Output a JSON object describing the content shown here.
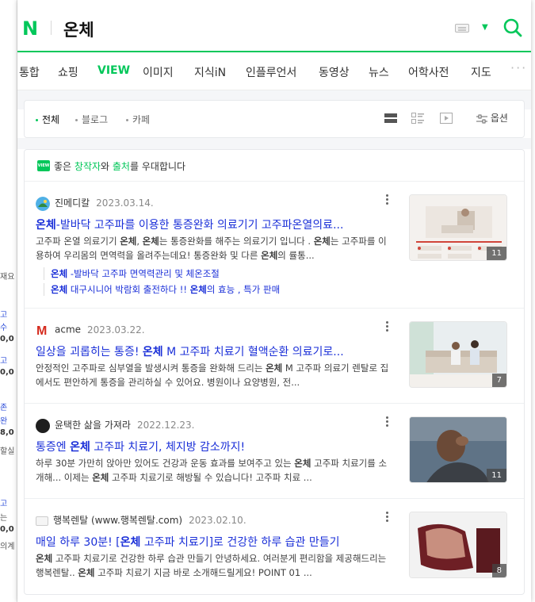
{
  "search": {
    "query": "온체",
    "logo": "N"
  },
  "tabs": [
    {
      "label": "통합"
    },
    {
      "label": "쇼핑"
    },
    {
      "label": "VIEW"
    },
    {
      "label": "이미지"
    },
    {
      "label": "지식iN"
    },
    {
      "label": "인플루언서"
    },
    {
      "label": "동영상"
    },
    {
      "label": "뉴스"
    },
    {
      "label": "어학사전"
    },
    {
      "label": "지도"
    }
  ],
  "filters": {
    "all": "전체",
    "blog": "블로그",
    "cafe": "카페",
    "options": "옵션"
  },
  "notice": {
    "badge": "VIEW",
    "pre": "좋은 ",
    "creator": "창작자",
    "mid": "와 ",
    "source": "출처",
    "post": "를 우대합니다"
  },
  "results": [
    {
      "source": "진메디칼",
      "date": "2023.03.14.",
      "title": "온체-발바닥 고주파를 이용한 통증완화 의료기기 고주파온열의료...",
      "desc": "고주파 온열 의료기기 온체, 온체는 통증완화를 해주는 의료기기 입니다 . 온체는 고주파를 이용하여 우리몸의 면역력을 올려주는데요! 통증완화 및 다른 온체의 률통...",
      "sub1": "온체 -발바닥 고주파 면역력관리 및 체온조절",
      "sub2": "온체 대구시니어 박람회 출전하다 !! 온체의 효능 , 특가 판매",
      "count": "11"
    },
    {
      "source": "acme",
      "date": "2023.03.22.",
      "title": "일상을 괴롭히는 통증! 온체 M 고주파 치료기 혈액순환 의료기로...",
      "desc": "안정적인 고주파로 심부열을 발생시켜 통증을 완화해 드리는 온체 M 고주파 의료기 렌탈로 집에서도 편안하게 통증을 관리하실 수 있어요. 병원이나 요양병원, 전...",
      "count": "7"
    },
    {
      "source": "윤택한 삶을 가져라",
      "date": "2022.12.23.",
      "title": "통증엔 온체 고주파 치료기, 체지방 감소까지!",
      "desc": "하루 30분 가만히 앉아만 있어도 건강과 운동 효과를 보여주고 있는 온체 고주파 치료기를 소개해... 이제는 온체 고주파 치료기로 해방될 수 있습니다! 고주파 치료 ...",
      "count": "11"
    },
    {
      "source": "행복렌탈 (www.행복렌탈.com)",
      "date": "2023.02.10.",
      "title": "매일 하루 30분! [온체 고주파 치료기]로 건강한 하루 습관 만들기",
      "desc": "온체 고주파 치료기로 건강한 하루 습관 만들기 안녕하세요. 여러분게 편리함을 제공해드리는 행복렌탈.. 온체 고주파 치료기 지금 바로 소개해드릴게요! POINT 01 ...",
      "count": "8"
    }
  ],
  "background_fragments": [
    "재요",
    "고",
    "수",
    "0,0",
    "고",
    "0,0",
    "존",
    "완",
    "8,0",
    "할실",
    "고",
    "는",
    "0,0",
    "의계"
  ],
  "colors": {
    "brand": "#03c75a",
    "link": "#1a2fd8"
  }
}
